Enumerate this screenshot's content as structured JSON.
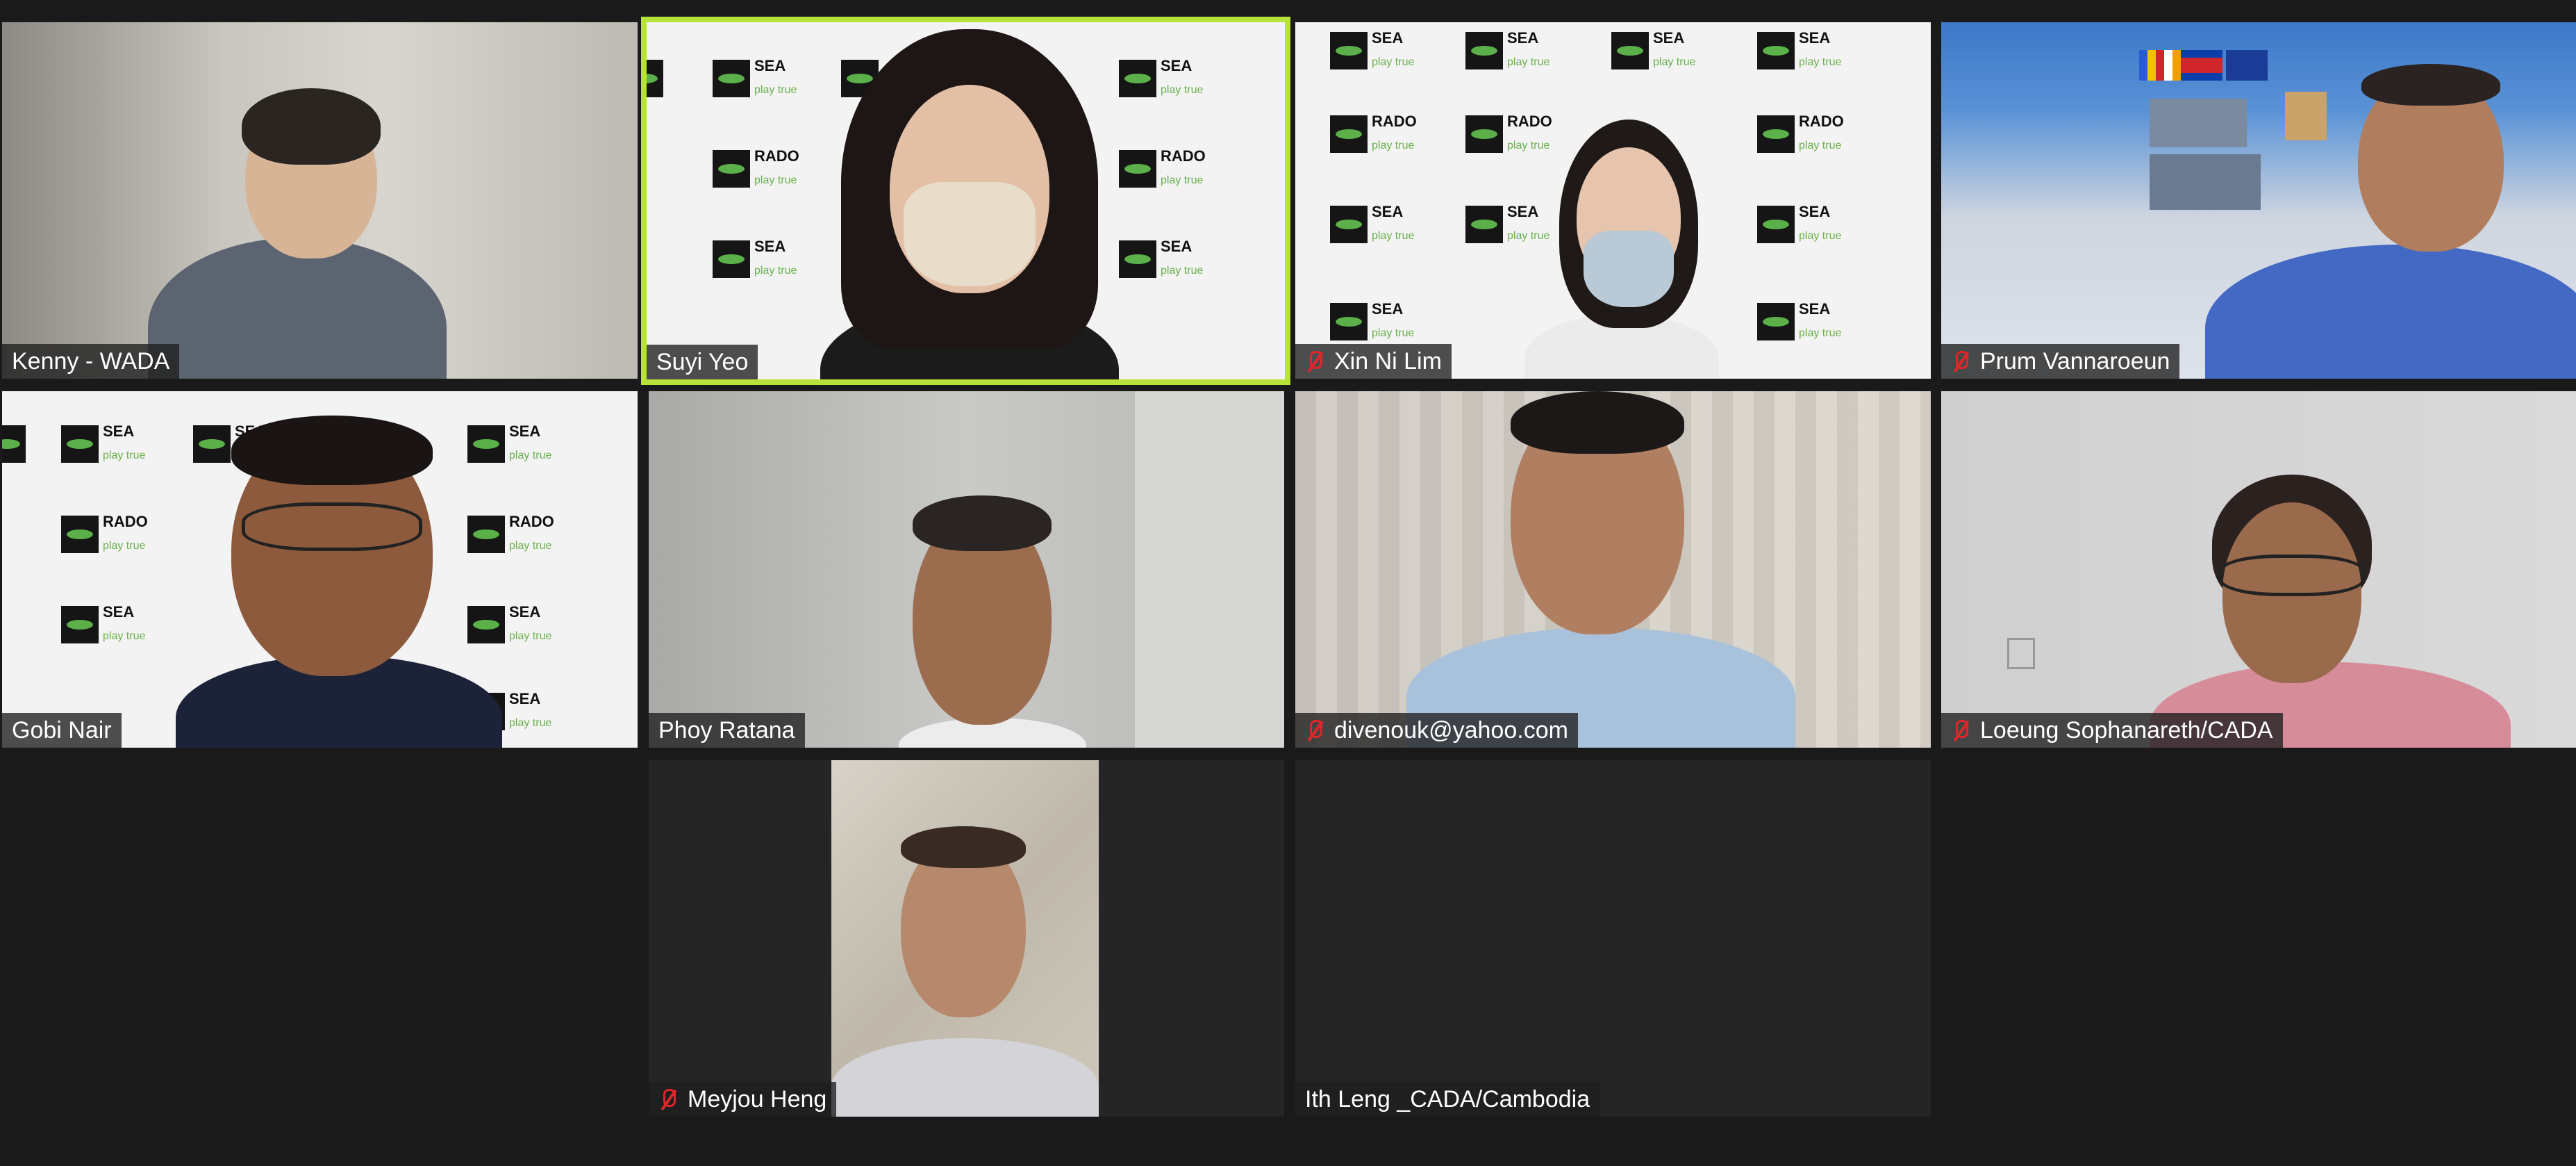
{
  "participants": [
    {
      "name": "Kenny - WADA",
      "muted": false,
      "active": false
    },
    {
      "name": "Suyi Yeo",
      "muted": false,
      "active": true
    },
    {
      "name": "Xin Ni Lim",
      "muted": true,
      "active": false
    },
    {
      "name": "Prum Vannaroeun",
      "muted": true,
      "active": false
    },
    {
      "name": "Gobi Nair",
      "muted": false,
      "active": false
    },
    {
      "name": "Phoy Ratana",
      "muted": false,
      "active": false
    },
    {
      "name": "divenouk@yahoo.com",
      "muted": true,
      "active": false
    },
    {
      "name": "Loeung Sophanareth/CADA",
      "muted": true,
      "active": false
    },
    {
      "name": "Meyjou Heng",
      "muted": true,
      "active": false
    },
    {
      "name": "Ith Leng _CADA/Cambodia",
      "muted": false,
      "active": false
    }
  ],
  "backdrop_logo": {
    "line1": "SEA",
    "line2": "RADO",
    "tagline": "play true"
  },
  "colors": {
    "active_border": "#b6e23a",
    "muted_icon": "#e0252b",
    "background": "#1a1a1a"
  }
}
